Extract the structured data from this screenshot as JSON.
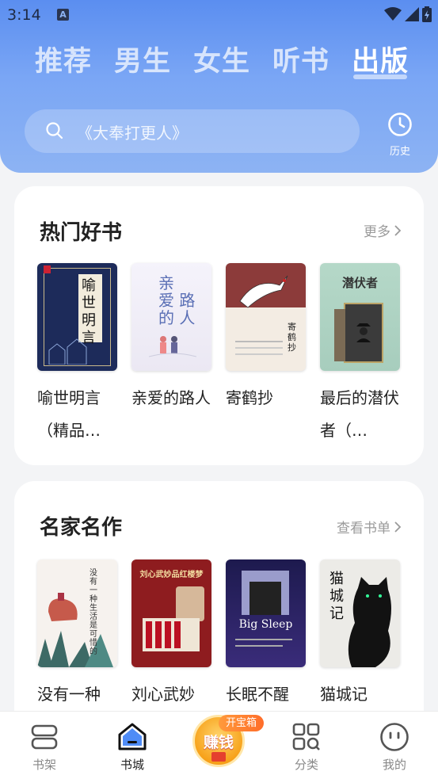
{
  "status": {
    "time": "3:14"
  },
  "tabs": [
    {
      "label": "推荐"
    },
    {
      "label": "男生"
    },
    {
      "label": "女生"
    },
    {
      "label": "听书"
    },
    {
      "label": "出版"
    }
  ],
  "search": {
    "placeholder": "《大奉打更人》"
  },
  "history": {
    "label": "历史"
  },
  "hot_books": {
    "title": "热门好书",
    "more": "更多",
    "books": [
      {
        "title": "喻世明言（精品…",
        "cover_text": "喻世明言"
      },
      {
        "title": "亲爱的路人",
        "cover_text": "亲爱的路人"
      },
      {
        "title": "寄鹤抄",
        "cover_text": "寄鹤抄"
      },
      {
        "title": "最后的潜伏者（…",
        "cover_text": "最后的潜伏者"
      }
    ]
  },
  "famous_works": {
    "title": "名家名作",
    "more": "查看书单",
    "books": [
      {
        "title": "没有一种",
        "cover_text": "没有一种"
      },
      {
        "title": "刘心武妙",
        "cover_text": "刘心武妙品红楼梦"
      },
      {
        "title": "长眠不醒",
        "cover_text": "The Big Sleep"
      },
      {
        "title": "猫城记",
        "cover_text": "猫城记"
      }
    ]
  },
  "bottom_nav": {
    "bookshelf": "书架",
    "bookstore": "书城",
    "earn": "赚钱",
    "treasure": "开宝箱",
    "category": "分类",
    "mine": "我的"
  },
  "colors": {
    "header_top": "#5b8ef0",
    "header_bottom": "#8db3f3",
    "accent_orange": "#f7a21b"
  }
}
